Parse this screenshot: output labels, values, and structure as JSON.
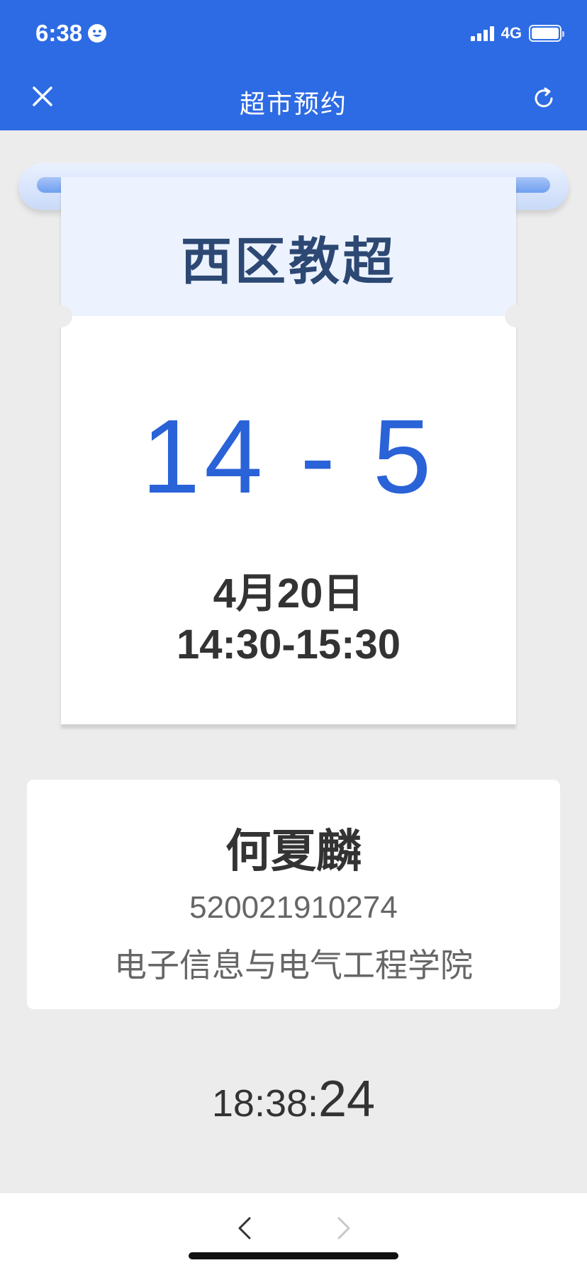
{
  "status_bar": {
    "time": "6:38",
    "network": "4G"
  },
  "navbar": {
    "title": "超市预约"
  },
  "ticket": {
    "store_name": "西区教超",
    "slot_number": "14 - 5",
    "date": "4月20日",
    "time_range": "14:30-15:30"
  },
  "user": {
    "name": "何夏麟",
    "student_id": "520021910274",
    "department": "电子信息与电气工程学院"
  },
  "clock": {
    "hours_minutes": "18:38:",
    "seconds": "24"
  },
  "colors": {
    "accent": "#2d6be4",
    "slot_blue": "#2a62d8",
    "ticket_header_bg": "#edf3fe",
    "store_name_text": "#2c4873"
  }
}
